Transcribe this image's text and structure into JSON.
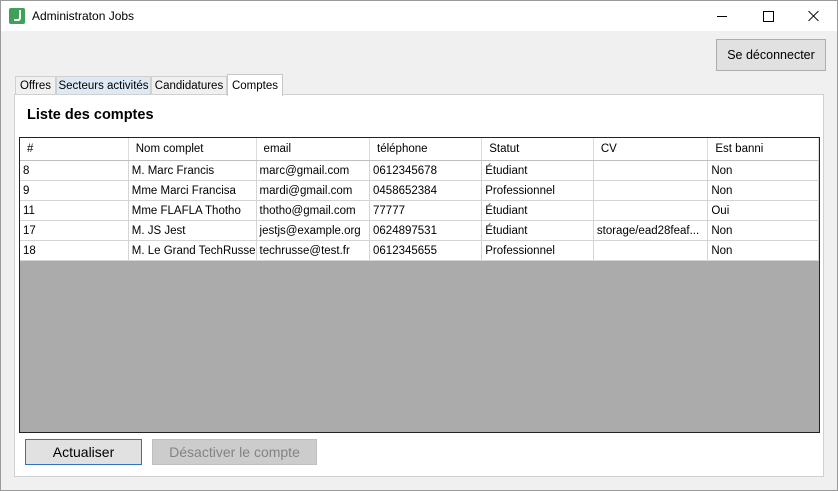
{
  "window": {
    "title": "Administraton Jobs"
  },
  "toolbar": {
    "logout_label": "Se déconnecter"
  },
  "tabs": [
    {
      "label": "Offres"
    },
    {
      "label": "Secteurs activités"
    },
    {
      "label": "Candidatures"
    },
    {
      "label": "Comptes"
    }
  ],
  "section": {
    "title": "Liste des comptes"
  },
  "table": {
    "columns": [
      "#",
      "Nom complet",
      "email",
      "téléphone",
      "Statut",
      "CV",
      "Est banni"
    ],
    "rows": [
      [
        "8",
        "M. Marc Francis",
        "marc@gmail.com",
        "0612345678",
        "Étudiant",
        "",
        "Non"
      ],
      [
        "9",
        "Mme Marci Francisa",
        "mardi@gmail.com",
        "0458652384",
        "Professionnel",
        "",
        "Non"
      ],
      [
        "11",
        "Mme FLAFLA Thotho",
        "thotho@gmail.com",
        "77777",
        "Étudiant",
        "",
        "Oui"
      ],
      [
        "17",
        "M. JS Jest",
        "jestjs@example.org",
        "0624897531",
        "Étudiant",
        "storage/ead28feaf...",
        "Non"
      ],
      [
        "18",
        "M. Le Grand TechRusse",
        "techrusse@test.fr",
        "0612345655",
        "Professionnel",
        "",
        "Non"
      ]
    ]
  },
  "actions": {
    "refresh_label": "Actualiser",
    "disable_label": "Désactiver le compte"
  },
  "colors": {
    "accent_border": "#2d72c7",
    "grid_background": "#ababab",
    "tab_highlight": "#dde9f5"
  }
}
